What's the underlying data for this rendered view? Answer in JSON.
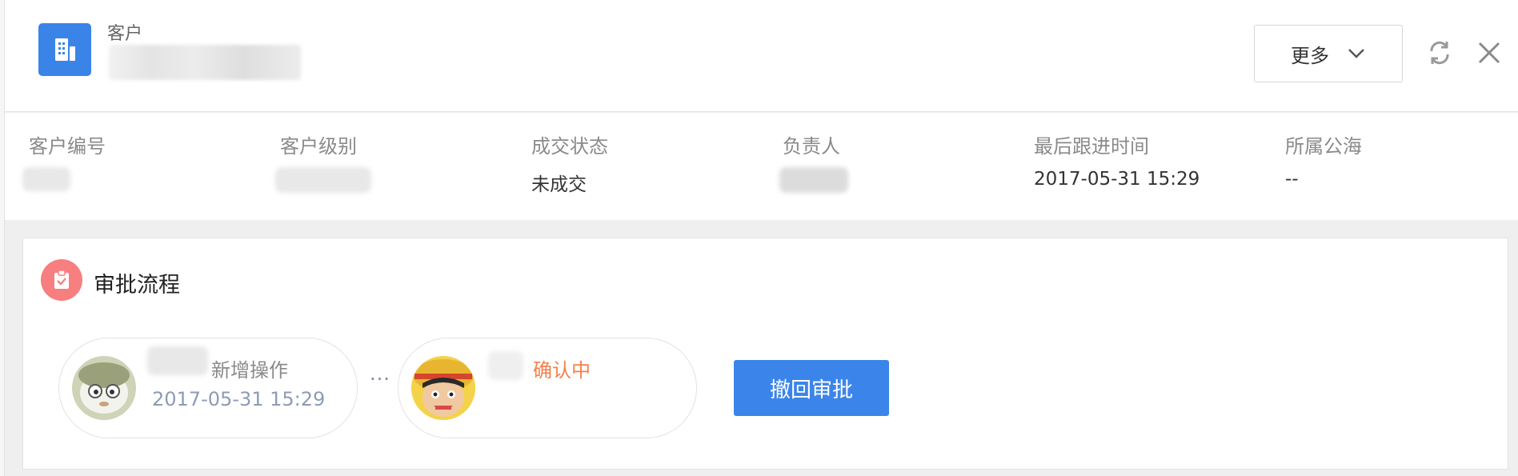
{
  "header": {
    "record_type": "客户",
    "more_label": "更多"
  },
  "info_fields": [
    {
      "label": "客户编号",
      "value": ""
    },
    {
      "label": "客户级别",
      "value": ""
    },
    {
      "label": "成交状态",
      "value": "未成交"
    },
    {
      "label": "负责人",
      "value": ""
    },
    {
      "label": "最后跟进时间",
      "value": "2017-05-31 15:29"
    },
    {
      "label": "所属公海",
      "value": "--"
    }
  ],
  "approval": {
    "title": "审批流程",
    "steps": [
      {
        "action": "新增操作",
        "time": "2017-05-31 15:29"
      },
      {
        "status": "确认中"
      }
    ],
    "separator": "···",
    "revoke_label": "撤回审批"
  },
  "colors": {
    "brand": "#3a84e8",
    "approval_icon": "#f77f7f",
    "pending_status": "#f5804a",
    "button": "#3b85ea"
  },
  "icons": {
    "logo": "building-icon",
    "more": "chevron-down-icon",
    "refresh": "refresh-icon",
    "close": "close-icon",
    "approval": "clipboard-check-icon"
  }
}
